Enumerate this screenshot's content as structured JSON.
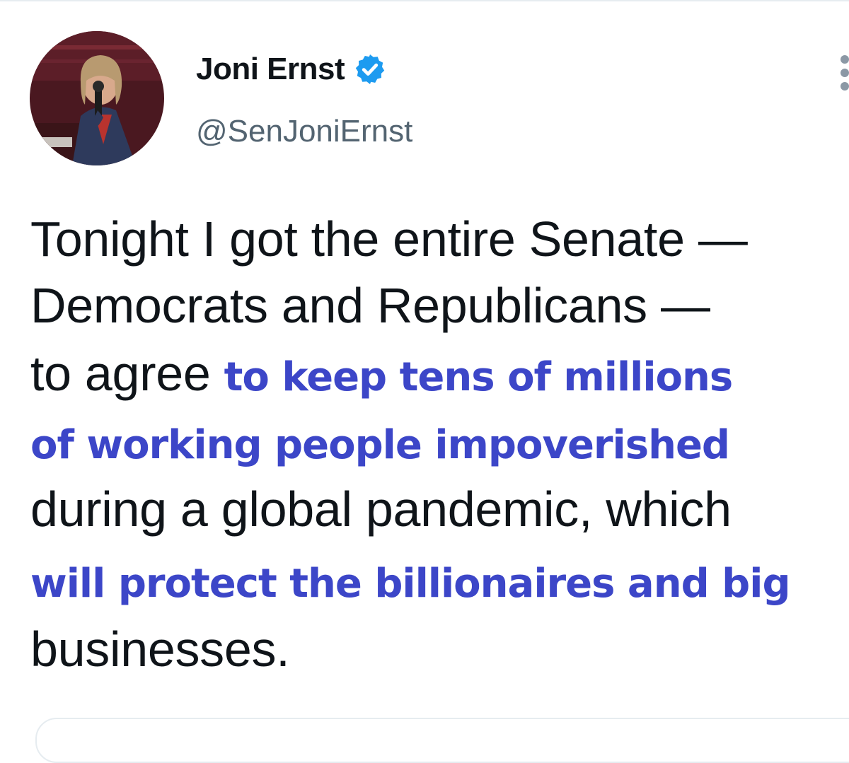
{
  "tweet": {
    "display_name": "Joni Ernst",
    "handle": "@SenJoniErnst",
    "verified": true,
    "verified_icon": "verified-badge-icon",
    "more_icon": "more-options-icon",
    "body_lines": [
      [
        {
          "text": "Tonight I got the entire Senate —",
          "highlight": false
        }
      ],
      [
        {
          "text": "Democrats and Republicans —",
          "highlight": false
        }
      ],
      [
        {
          "text": "to agree ",
          "highlight": false
        },
        {
          "text": "to keep tens of millions",
          "highlight": true
        }
      ],
      [
        {
          "text": "of working people impoverished",
          "highlight": true
        }
      ],
      [
        {
          "text": "during a global pandemic, which",
          "highlight": false
        }
      ],
      [
        {
          "text": "will protect the billionaires and big",
          "highlight": true
        }
      ],
      [
        {
          "text": "businesses.",
          "highlight": false
        }
      ]
    ]
  },
  "colors": {
    "highlight": "#3c46c8",
    "text": "#0f1419",
    "secondary": "#536471",
    "verified": "#1d9bf0"
  }
}
